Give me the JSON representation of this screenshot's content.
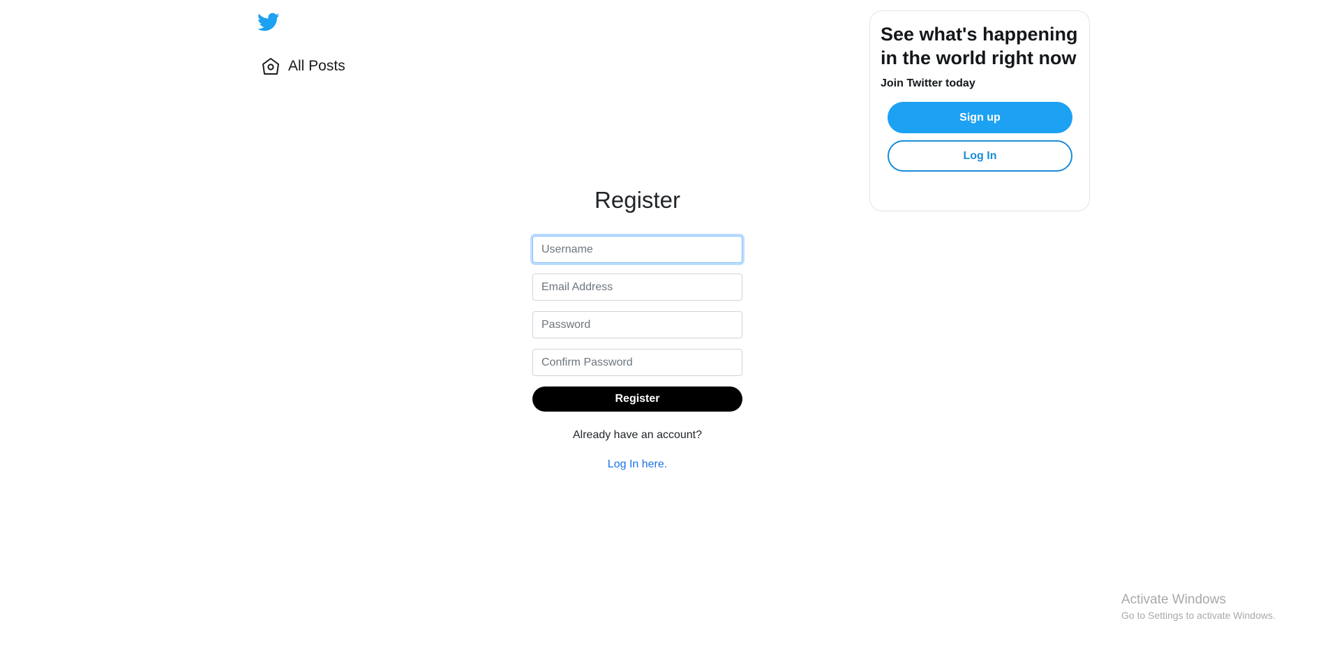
{
  "colors": {
    "brand_blue": "#1da1f2",
    "link_blue": "#1a73e8",
    "button_black": "#000000",
    "outline_blue": "#1a8cd8"
  },
  "icons": {
    "brand": "twitter-bird-icon",
    "nav_all_posts": "home-icon"
  },
  "sidebar": {
    "items": [
      {
        "label": "All Posts",
        "icon": "home-icon"
      }
    ]
  },
  "register": {
    "title": "Register",
    "fields": {
      "username": {
        "placeholder": "Username",
        "value": ""
      },
      "email": {
        "placeholder": "Email Address",
        "value": ""
      },
      "password": {
        "placeholder": "Password",
        "value": ""
      },
      "confirm_password": {
        "placeholder": "Confirm Password",
        "value": ""
      }
    },
    "submit_label": "Register",
    "already_text": "Already have an account?",
    "login_link": "Log In here."
  },
  "card": {
    "heading": "See what's happening in the world right now",
    "subheading": "Join Twitter today",
    "signup_label": "Sign up",
    "login_label": "Log In"
  },
  "watermark": {
    "title": "Activate Windows",
    "subtitle": "Go to Settings to activate Windows."
  }
}
